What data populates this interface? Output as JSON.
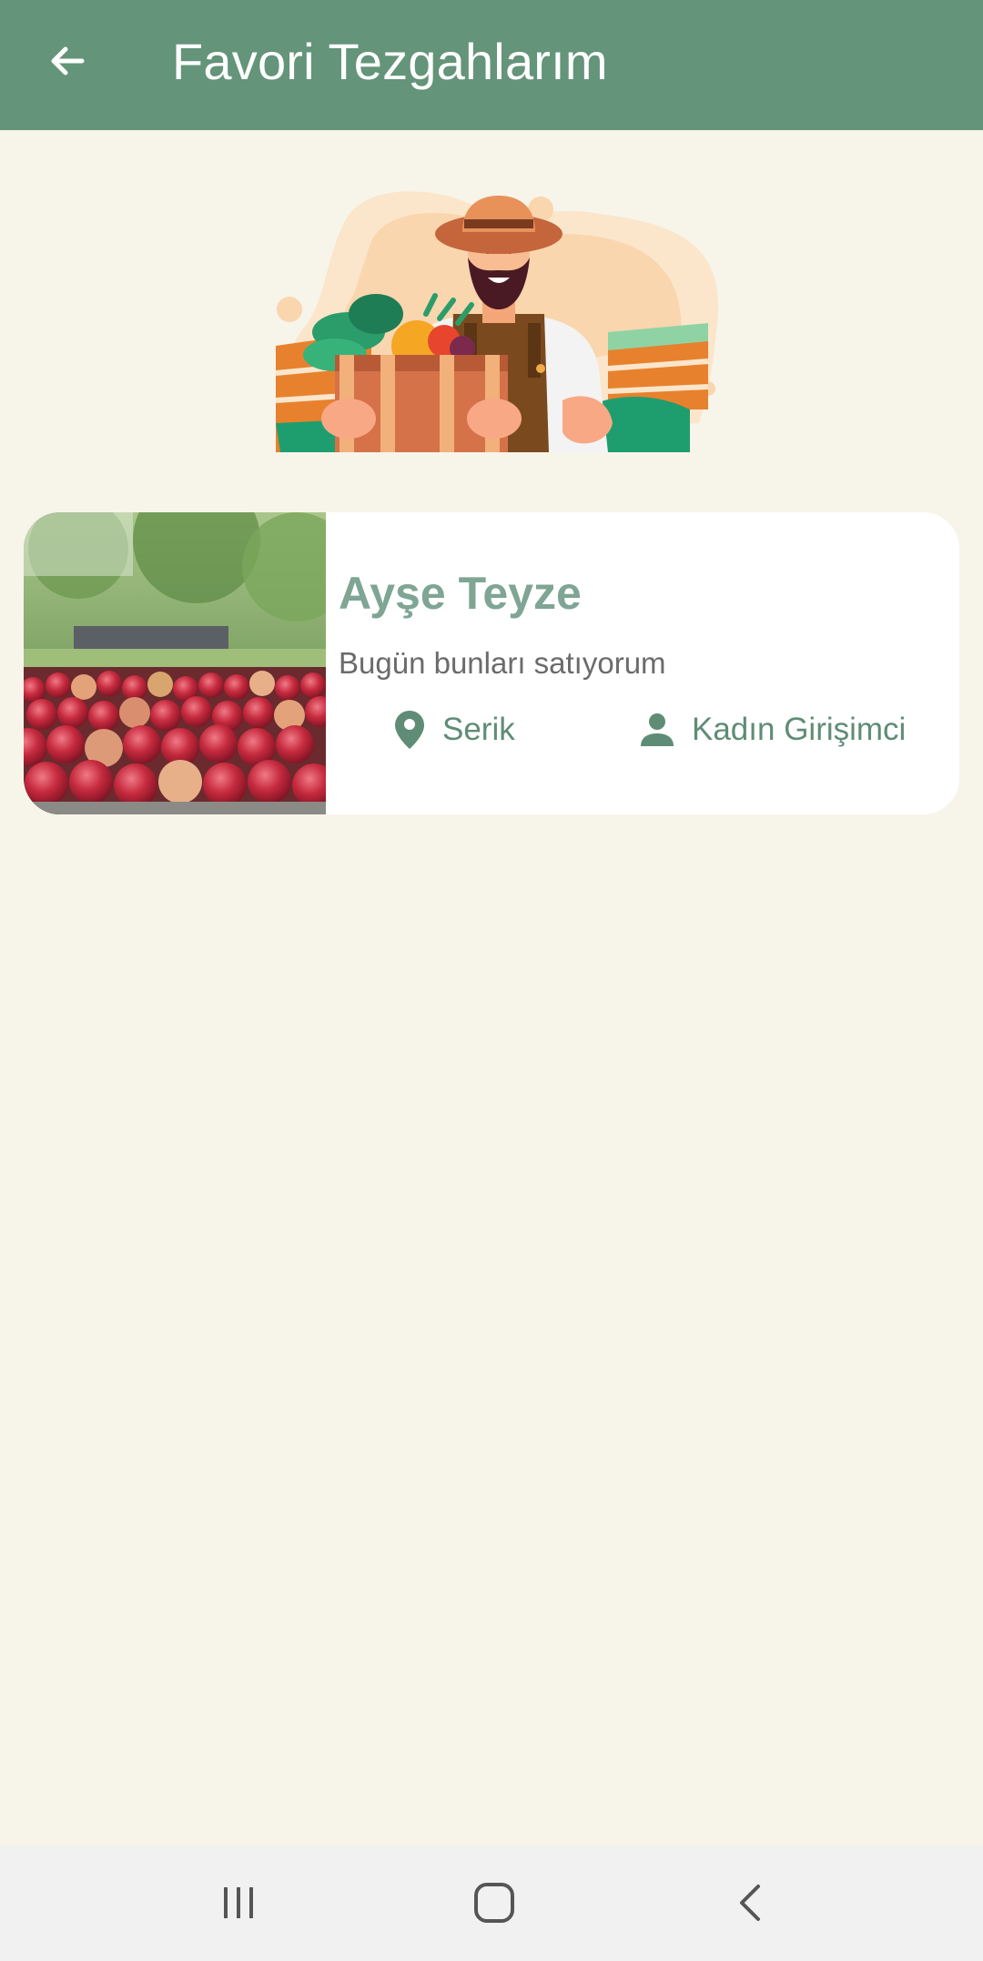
{
  "app_bar": {
    "title": "Favori Tezgahlarım",
    "back_icon": "arrow-left-icon",
    "background": "#649479"
  },
  "hero": {
    "illustration": "farmer-with-vegetable-crate"
  },
  "favorites": [
    {
      "name": "Ayşe Teyze",
      "subtitle": "Bugün bunları satıyorum",
      "location": "Serik",
      "location_icon": "location-pin-icon",
      "category": "Kadın Girişimci",
      "category_icon": "person-icon",
      "image": "apples-photo"
    }
  ],
  "system_nav": {
    "recents_icon": "recents-icon",
    "home_icon": "home-icon",
    "back_icon": "back-chevron-icon"
  },
  "colors": {
    "background": "#f7f4ea",
    "accent": "#649479",
    "name": "#7fa594",
    "meta": "#5f8c75"
  }
}
